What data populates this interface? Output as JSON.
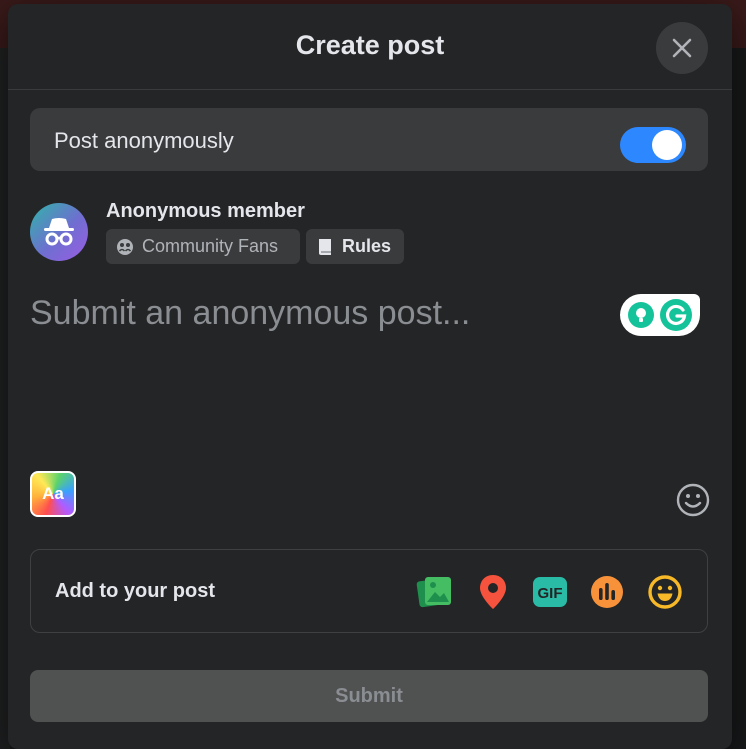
{
  "dialog": {
    "title": "Create post",
    "close_icon": "close-icon"
  },
  "anonymous": {
    "label": "Post anonymously",
    "enabled": true,
    "toggle_color": "#2d88ff"
  },
  "author": {
    "name": "Anonymous member",
    "avatar_icon": "incognito-icon",
    "group_chip": {
      "icon": "group-icon",
      "label": "Community Fans"
    },
    "rules_chip": {
      "icon": "book-icon",
      "label": "Rules"
    }
  },
  "composer": {
    "placeholder": "Submit an anonymous post...",
    "text_format_label": "Aa",
    "grammarly_icon": "grammarly-icon",
    "emoji_icon": "emoji-icon"
  },
  "add_to_post": {
    "label": "Add to your post",
    "icons": [
      "photo-video-icon",
      "location-pin-icon",
      "gif-icon",
      "poll-icon",
      "feeling-icon"
    ],
    "gif_label": "GIF"
  },
  "submit": {
    "label": "Submit",
    "disabled": true
  }
}
